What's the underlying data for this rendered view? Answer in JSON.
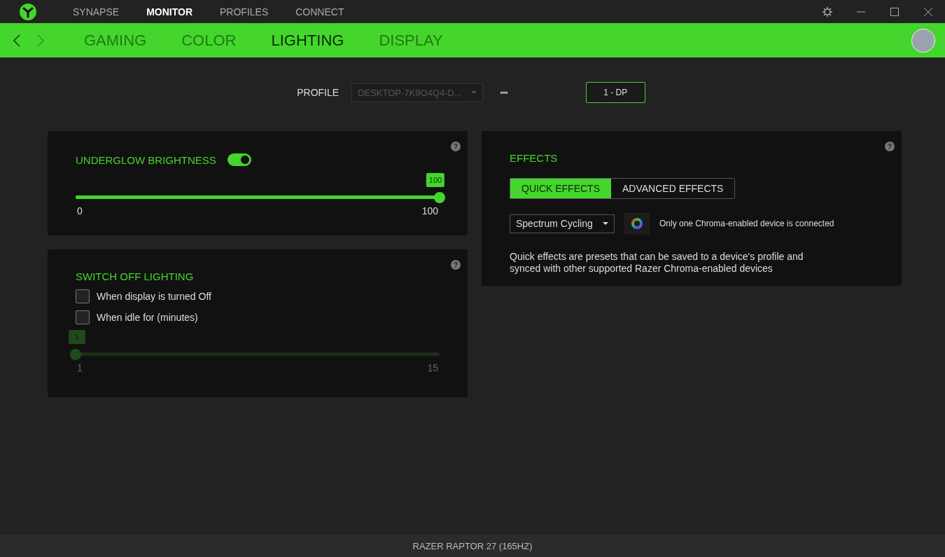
{
  "top_nav": [
    {
      "label": "SYNAPSE",
      "selected": false
    },
    {
      "label": "MONITOR",
      "selected": true
    },
    {
      "label": "PROFILES",
      "selected": false
    },
    {
      "label": "CONNECT",
      "selected": false
    }
  ],
  "sub_nav": [
    {
      "label": "GAMING",
      "selected": false
    },
    {
      "label": "COLOR",
      "selected": false
    },
    {
      "label": "LIGHTING",
      "selected": true
    },
    {
      "label": "DISPLAY",
      "selected": false
    }
  ],
  "profile": {
    "label": "PROFILE",
    "value": "DESKTOP-7K9O4Q4-D...",
    "more": "•••",
    "display_button": "1 - DP"
  },
  "underglow": {
    "title": "UNDERGLOW BRIGHTNESS",
    "help": "?",
    "on": true,
    "slider": {
      "level": 1,
      "badge": "100",
      "min": "0",
      "max": "100",
      "disabled": false
    }
  },
  "switch_off": {
    "title": "SWITCH OFF LIGHTING",
    "help": "?",
    "options": [
      {
        "label": "When display is turned Off",
        "checked": false
      },
      {
        "label": "When idle for (minutes)",
        "checked": false
      }
    ],
    "slider": {
      "level": 0,
      "badge": "1",
      "min": "1",
      "max": "15",
      "disabled": true
    }
  },
  "effects": {
    "title": "EFFECTS",
    "help": "?",
    "tabs": [
      {
        "label": "QUICK EFFECTS",
        "selected": true
      },
      {
        "label": "ADVANCED EFFECTS",
        "selected": false
      }
    ],
    "effect": "Spectrum Cycling",
    "note": "Only one Chroma-enabled device is connected",
    "description": "Quick effects are presets that can be saved to a device's profile and synced with other supported Razer Chroma-enabled devices"
  },
  "status_bar": "RAZER RAPTOR 27 (165HZ)"
}
